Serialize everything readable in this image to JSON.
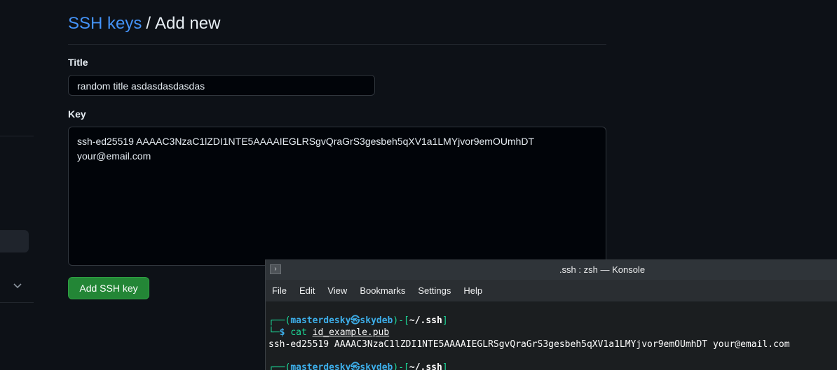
{
  "header": {
    "breadcrumb_link": "SSH keys",
    "breadcrumb_sep": "/",
    "breadcrumb_current": "Add new"
  },
  "form": {
    "title_label": "Title",
    "title_value": "random title asdasdasdasdas",
    "key_label": "Key",
    "key_value": "ssh-ed25519 AAAAC3NzaC1lZDI1NTE5AAAAIEGLRSgvQraGrS3gesbeh5qXV1a1LMYjvor9emOUmhDT\nyour@email.com",
    "submit_label": "Add SSH key"
  },
  "konsole": {
    "window_title": ".ssh : zsh — Konsole",
    "menu": [
      "File",
      "Edit",
      "View",
      "Bookmarks",
      "Settings",
      "Help"
    ],
    "prompt_user": "masterdesky",
    "prompt_symbol": "㉿",
    "prompt_host": "skydeb",
    "prompt_path": "~/.ssh",
    "command": "cat",
    "command_arg": "id_example.pub",
    "output": "ssh-ed25519 AAAAC3NzaC1lZDI1NTE5AAAAIEGLRSgvQraGrS3gesbeh5qXV1a1LMYjvor9emOUmhDT your@email.com"
  },
  "icons": {
    "sidebar_chevron": "chevron-down-icon",
    "konsole_app": "terminal-icon"
  },
  "colors": {
    "background": "#0d1117",
    "link": "#4493f8",
    "button": "#238636",
    "terminal_bg": "#1b1e20",
    "prompt_blue": "#3daee9",
    "prompt_green": "#1cdc9a"
  }
}
